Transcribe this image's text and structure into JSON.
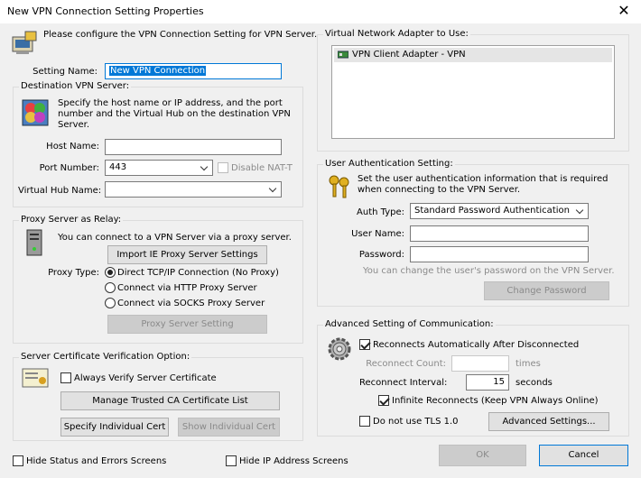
{
  "window": {
    "title": "New VPN Connection Setting Properties",
    "close_glyph": "✕"
  },
  "intro": {
    "text": "Please configure the VPN Connection Setting for VPN Server."
  },
  "setting_name": {
    "label": "Setting Name:",
    "value": "New VPN Connection"
  },
  "destination": {
    "group_title": "Destination VPN Server:",
    "description": "Specify the host name or IP address, and the port number and the Virtual Hub on the destination VPN Server.",
    "host_label": "Host Name:",
    "host_value": "",
    "port_label": "Port Number:",
    "port_value": "443",
    "disable_nat_label": "Disable NAT-T",
    "hub_label": "Virtual Hub Name:",
    "hub_value": ""
  },
  "proxy": {
    "group_title": "Proxy Server as Relay:",
    "description": "You can connect to a VPN Server via a proxy server.",
    "import_button": "Import IE Proxy Server Settings",
    "type_label": "Proxy Type:",
    "options": [
      "Direct TCP/IP Connection (No Proxy)",
      "Connect via HTTP Proxy Server",
      "Connect via SOCKS Proxy Server"
    ],
    "setting_button": "Proxy Server Setting"
  },
  "cert": {
    "group_title": "Server Certificate Verification Option:",
    "always_verify_label": "Always Verify Server Certificate",
    "manage_button": "Manage Trusted CA Certificate List",
    "specify_button": "Specify Individual Cert",
    "show_button": "Show Individual Cert"
  },
  "bottom": {
    "hide_status_label": "Hide Status and Errors Screens",
    "hide_ip_label": "Hide IP Address Screens",
    "ok_button": "OK",
    "cancel_button": "Cancel"
  },
  "adapter": {
    "group_title": "Virtual Network Adapter to Use:",
    "items": [
      "VPN Client Adapter - VPN"
    ]
  },
  "auth": {
    "group_title": "User Authentication Setting:",
    "description": "Set the user authentication information that is required when connecting to the VPN Server.",
    "type_label": "Auth Type:",
    "type_value": "Standard Password Authentication",
    "user_label": "User Name:",
    "user_value": "",
    "password_label": "Password:",
    "password_value": "",
    "change_hint": "You can change the user's password on the VPN Server.",
    "change_button": "Change Password"
  },
  "advanced": {
    "group_title": "Advanced Setting of Communication:",
    "reconnect_label": "Reconnects Automatically After Disconnected",
    "reconnect_count_label": "Reconnect Count:",
    "reconnect_count_value": "",
    "times_label": "times",
    "interval_label": "Reconnect Interval:",
    "interval_value": "15",
    "seconds_label": "seconds",
    "infinite_label": "Infinite Reconnects (Keep VPN Always Online)",
    "no_tls_label": "Do not use TLS 1.0",
    "advanced_button": "Advanced Settings..."
  }
}
